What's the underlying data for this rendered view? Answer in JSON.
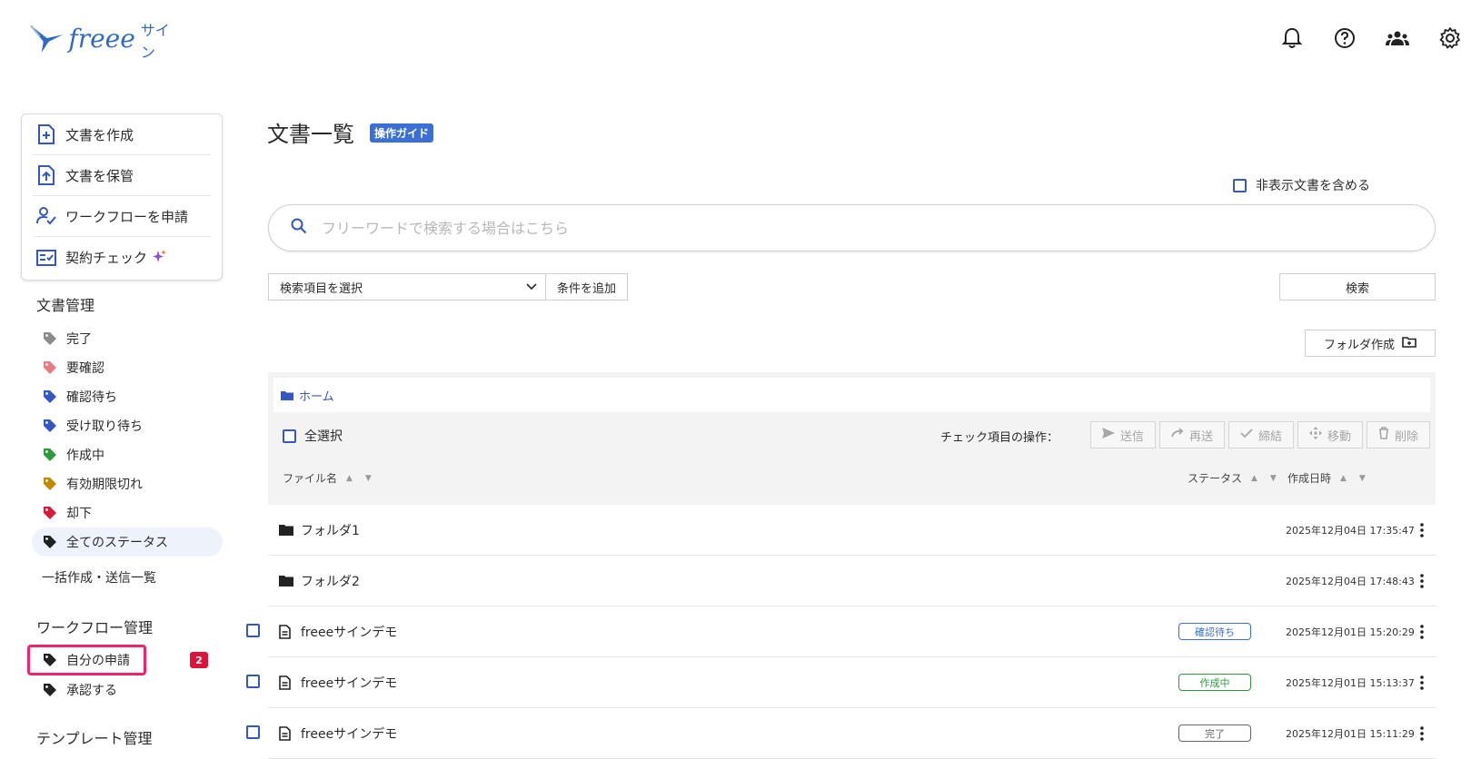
{
  "header": {
    "logo_text": "freee",
    "logo_sub": "サイン",
    "icons": [
      "bell-icon",
      "help-icon",
      "users-icon",
      "gear-icon"
    ]
  },
  "sidebar": {
    "actions": [
      {
        "label": "文書を作成",
        "icon": "file-plus-icon"
      },
      {
        "label": "文書を保管",
        "icon": "file-upload-icon"
      },
      {
        "label": "ワークフローを申請",
        "icon": "user-check-icon"
      },
      {
        "label": "契約チェック",
        "icon": "checklist-icon"
      }
    ],
    "doc_section_title": "文書管理",
    "statuses": [
      {
        "label": "完了",
        "color": "#8a8a8a"
      },
      {
        "label": "要確認",
        "color": "#e87a86"
      },
      {
        "label": "確認待ち",
        "color": "#3457c2"
      },
      {
        "label": "受け取り待ち",
        "color": "#3457c2"
      },
      {
        "label": "作成中",
        "color": "#2e9a3c"
      },
      {
        "label": "有効期限切れ",
        "color": "#c08a00"
      },
      {
        "label": "却下",
        "color": "#d61b3c"
      },
      {
        "label": "全てのステータス",
        "color": "#222222"
      }
    ],
    "batch_link": "一括作成・送信一覧",
    "wf_section_title": "ワークフロー管理",
    "wf_mine": "自分の申請",
    "wf_mine_count": "2",
    "wf_approve": "承認する",
    "template_section_title": "テンプレート管理"
  },
  "main": {
    "title": "文書一覧",
    "guide": "操作ガイド",
    "hidden_docs_label": "非表示文書を含める",
    "search_placeholder": "フリーワードで検索する場合はこちら",
    "field_select": "検索項目を選択",
    "add_condition": "条件を追加",
    "search_button": "検索",
    "folder_button": "フォルダ作成",
    "breadcrumb_home": "ホーム",
    "select_all": "全選択",
    "ops_label": "チェック項目の操作：",
    "ops": [
      "送信",
      "再送",
      "締結",
      "移動",
      "削除"
    ],
    "columns": {
      "name": "ファイル名",
      "status": "ステータス",
      "created": "作成日時"
    },
    "rows": [
      {
        "type": "folder",
        "name": "フォルダ1",
        "status": "",
        "date": "2025年12月04日 17:35:47"
      },
      {
        "type": "folder",
        "name": "フォルダ2",
        "status": "",
        "date": "2025年12月04日 17:48:43"
      },
      {
        "type": "file",
        "name": "freeeサインデモ",
        "status": "確認待ち",
        "date": "2025年12月01日 15:20:29"
      },
      {
        "type": "file",
        "name": "freeeサインデモ",
        "status": "作成中",
        "date": "2025年12月01日 15:13:37"
      },
      {
        "type": "file",
        "name": "freeeサインデモ",
        "status": "完了",
        "date": "2025年12月01日 15:11:29"
      }
    ]
  },
  "colors": {
    "accent": "#3457c2",
    "brand": "#2f6ac8",
    "highlight": "#f2226d"
  }
}
